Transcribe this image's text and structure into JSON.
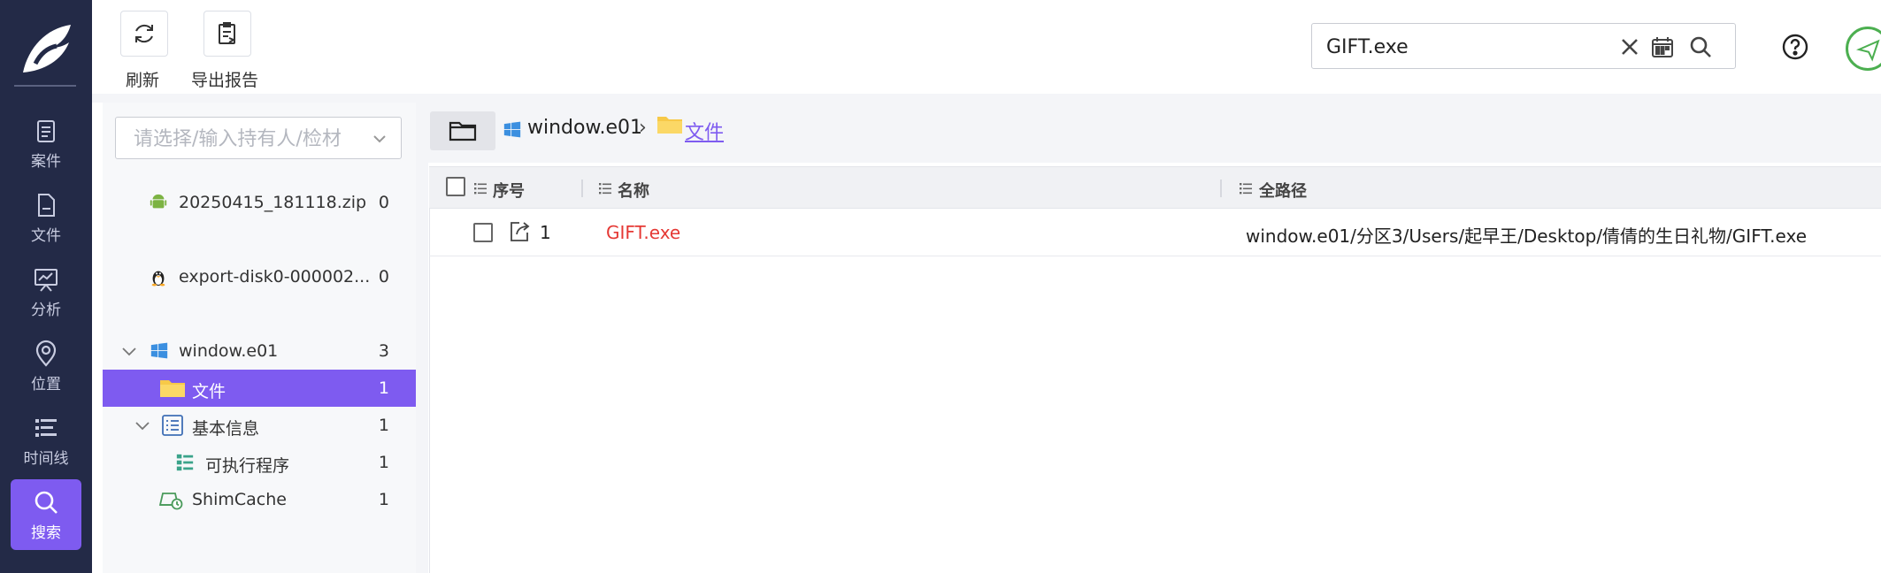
{
  "nav": {
    "items": [
      {
        "label": "案件"
      },
      {
        "label": "文件"
      },
      {
        "label": "分析"
      },
      {
        "label": "位置"
      },
      {
        "label": "时间线"
      },
      {
        "label": "搜索"
      }
    ]
  },
  "toolbar": {
    "refresh_label": "刷新",
    "export_label": "导出报告"
  },
  "search": {
    "value": "GIFT.exe"
  },
  "tree": {
    "select_placeholder": "请选择/输入持有人/检材",
    "items": [
      {
        "label": "20250415_181118.zip",
        "count": "0"
      },
      {
        "label": "export-disk0-000002...",
        "count": "0"
      },
      {
        "label": "window.e01",
        "count": "3"
      },
      {
        "label": "文件",
        "count": "1"
      },
      {
        "label": "基本信息",
        "count": "1"
      },
      {
        "label": "可执行程序",
        "count": "1"
      },
      {
        "label": "ShimCache",
        "count": "1"
      }
    ]
  },
  "breadcrumb": {
    "root": "window.e01",
    "separator": "›",
    "current": "文件"
  },
  "table": {
    "columns": [
      "序号",
      "名称",
      "全路径"
    ],
    "rows": [
      {
        "index": "1",
        "name": "GIFT.exe",
        "path": "window.e01/分区3/Users/起早王/Desktop/倩倩的生日礼物/GIFT.exe"
      }
    ]
  },
  "colors": {
    "nav_bg": "#232a47",
    "accent": "#7e5bf0",
    "file_name_red": "#e53935",
    "status_green": "#4caf50"
  }
}
